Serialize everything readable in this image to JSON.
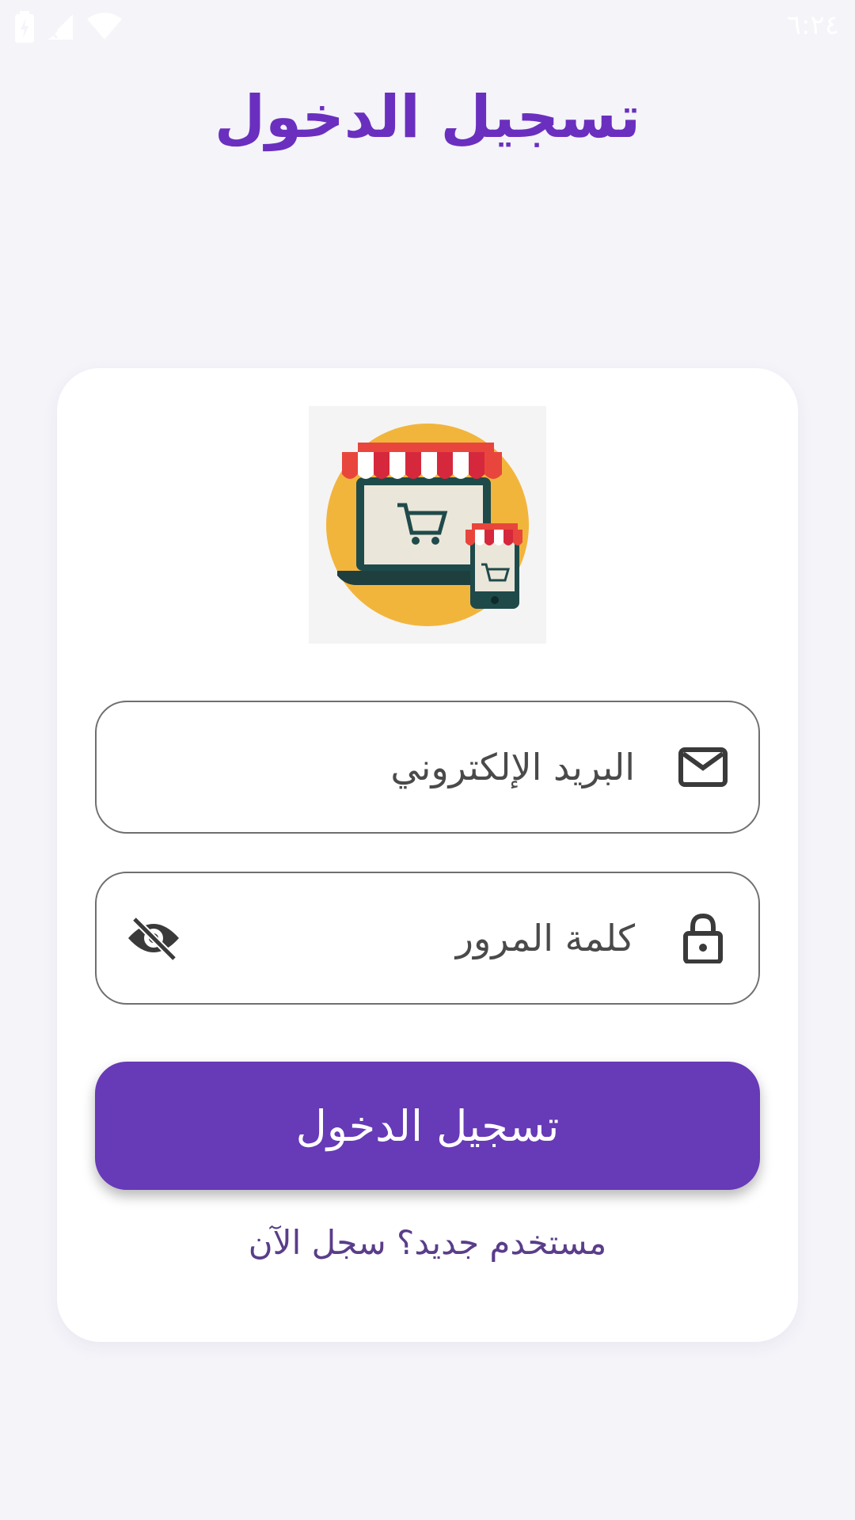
{
  "status_bar": {
    "time": "٦:٢٤",
    "icons": [
      "battery-charging-icon",
      "signal-off-icon",
      "wifi-icon"
    ]
  },
  "header": {
    "title": "تسجيل الدخول"
  },
  "logo": {
    "icon": "online-shop-logo-icon"
  },
  "form": {
    "email_placeholder": "البريد الإلكتروني",
    "email_icon": "mail-icon",
    "password_placeholder": "كلمة المرور",
    "password_icon": "lock-icon",
    "password_toggle_icon": "eye-off-icon",
    "login_label": "تسجيل الدخول",
    "register_label": "مستخدم جديد؟ سجل الآن"
  },
  "colors": {
    "accent": "#673ab7",
    "title": "#6a2fbf",
    "background": "#f4f4f9",
    "card": "#ffffff"
  }
}
